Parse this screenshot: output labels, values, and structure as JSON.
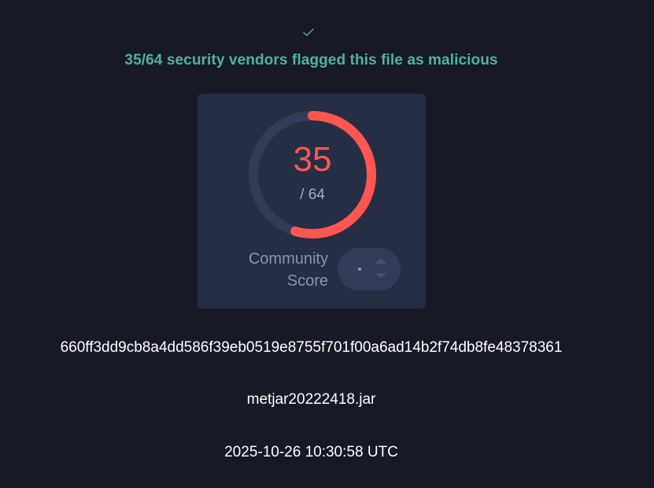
{
  "status": {
    "icon": "check-icon",
    "headline": "35/64 security vendors flagged this file as malicious",
    "color": "#4fb3a0"
  },
  "score": {
    "positives": "35",
    "total": "/ 64",
    "positives_count": 35,
    "total_count": 64,
    "ring_color": "#ff574f",
    "track_color": "#323c56"
  },
  "community": {
    "label_line1": "Community",
    "label_line2": "Score",
    "up_icon": "chevron-up-icon",
    "down_icon": "chevron-down-icon"
  },
  "file": {
    "hash": "660ff3dd9cb8a4dd586f39eb0519e8755f701f00a6ad14b2f74db8fe48378361",
    "name": "metjar20222418.jar",
    "date": "2025-10-26 10:30:58 UTC"
  }
}
